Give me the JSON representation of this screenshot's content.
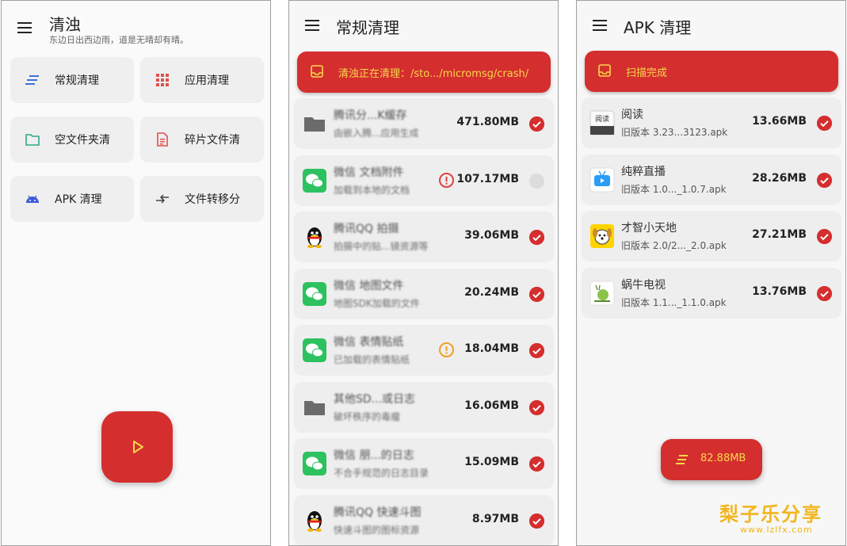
{
  "home": {
    "title": "清浊",
    "subtitle": "东边日出西边雨，道是无晴却有晴。",
    "tiles": [
      {
        "label": "常规清理",
        "icon": "lines-icon"
      },
      {
        "label": "应用清理",
        "icon": "grid-icon"
      },
      {
        "label": "空文件夹清",
        "icon": "folder-icon"
      },
      {
        "label": "碎片文件清",
        "icon": "document-icon"
      },
      {
        "label": "APK 清理",
        "icon": "android-icon"
      },
      {
        "label": "文件转移分",
        "icon": "transfer-icon"
      }
    ],
    "play_icon": "play-icon"
  },
  "regular": {
    "title": "常规清理",
    "banner": "清浊正在清理：/sto.../micromsg/crash/",
    "items": [
      {
        "name": "腾讯分...K缓存",
        "desc": "由嵌入腾...应用生成",
        "size": "471.80MB",
        "icon": "folder-icon",
        "checked": true,
        "warning": null
      },
      {
        "name": "微信 文档附件",
        "desc": "加载到本地的文档",
        "size": "107.17MB",
        "icon": "wechat-icon",
        "checked": false,
        "warning": "red"
      },
      {
        "name": "腾讯QQ 拍摄",
        "desc": "拍摄中的贴...镜资源等",
        "size": "39.06MB",
        "icon": "qq-penguin-icon",
        "checked": true,
        "warning": null
      },
      {
        "name": "微信 地图文件",
        "desc": "地图SDK加载的文件",
        "size": "20.24MB",
        "icon": "wechat-icon",
        "checked": true,
        "warning": null
      },
      {
        "name": "微信 表情贴纸",
        "desc": "已加载的表情贴纸",
        "size": "18.04MB",
        "icon": "wechat-icon",
        "checked": true,
        "warning": "orange"
      },
      {
        "name": "其他SD...或日志",
        "desc": "破坏秩序的毒瘤",
        "size": "16.06MB",
        "icon": "folder-icon",
        "checked": true,
        "warning": null
      },
      {
        "name": "微信 朋...的日志",
        "desc": "不合手规范的日志目录",
        "size": "15.09MB",
        "icon": "wechat-icon",
        "checked": true,
        "warning": null
      },
      {
        "name": "腾讯QQ 快速斗图",
        "desc": "快速斗图的图标资源",
        "size": "8.97MB",
        "icon": "qq-penguin-icon",
        "checked": true,
        "warning": null
      }
    ]
  },
  "apk": {
    "title": "APK 清理",
    "banner": "扫描完成",
    "items": [
      {
        "name": "阅读",
        "desc": "旧版本 3.23...3123.apk",
        "size": "13.66MB",
        "icon": "reader-app-icon",
        "icon_text": "阅读",
        "checked": true
      },
      {
        "name": "纯粹直播",
        "desc": "旧版本 1.0..._1.0.7.apk",
        "size": "28.26MB",
        "icon": "tv-app-icon",
        "icon_text": "",
        "checked": true
      },
      {
        "name": "才智小天地",
        "desc": "旧版本 2.0/2..._2.0.apk",
        "size": "27.21MB",
        "icon": "puppy-app-icon",
        "icon_text": "",
        "checked": true
      },
      {
        "name": "蜗牛电视",
        "desc": "旧版本 1.1..._1.1.0.apk",
        "size": "13.76MB",
        "icon": "snail-app-icon",
        "icon_text": "",
        "checked": true
      }
    ],
    "total": "82.88MB"
  },
  "watermark": {
    "main": "梨子乐分享",
    "sub": "www.lzlfx.com"
  },
  "colors": {
    "accent": "#d52e2e",
    "banner_text": "#f5d84a",
    "wechat": "#2dc15f",
    "watermark": "#f2b51d"
  }
}
